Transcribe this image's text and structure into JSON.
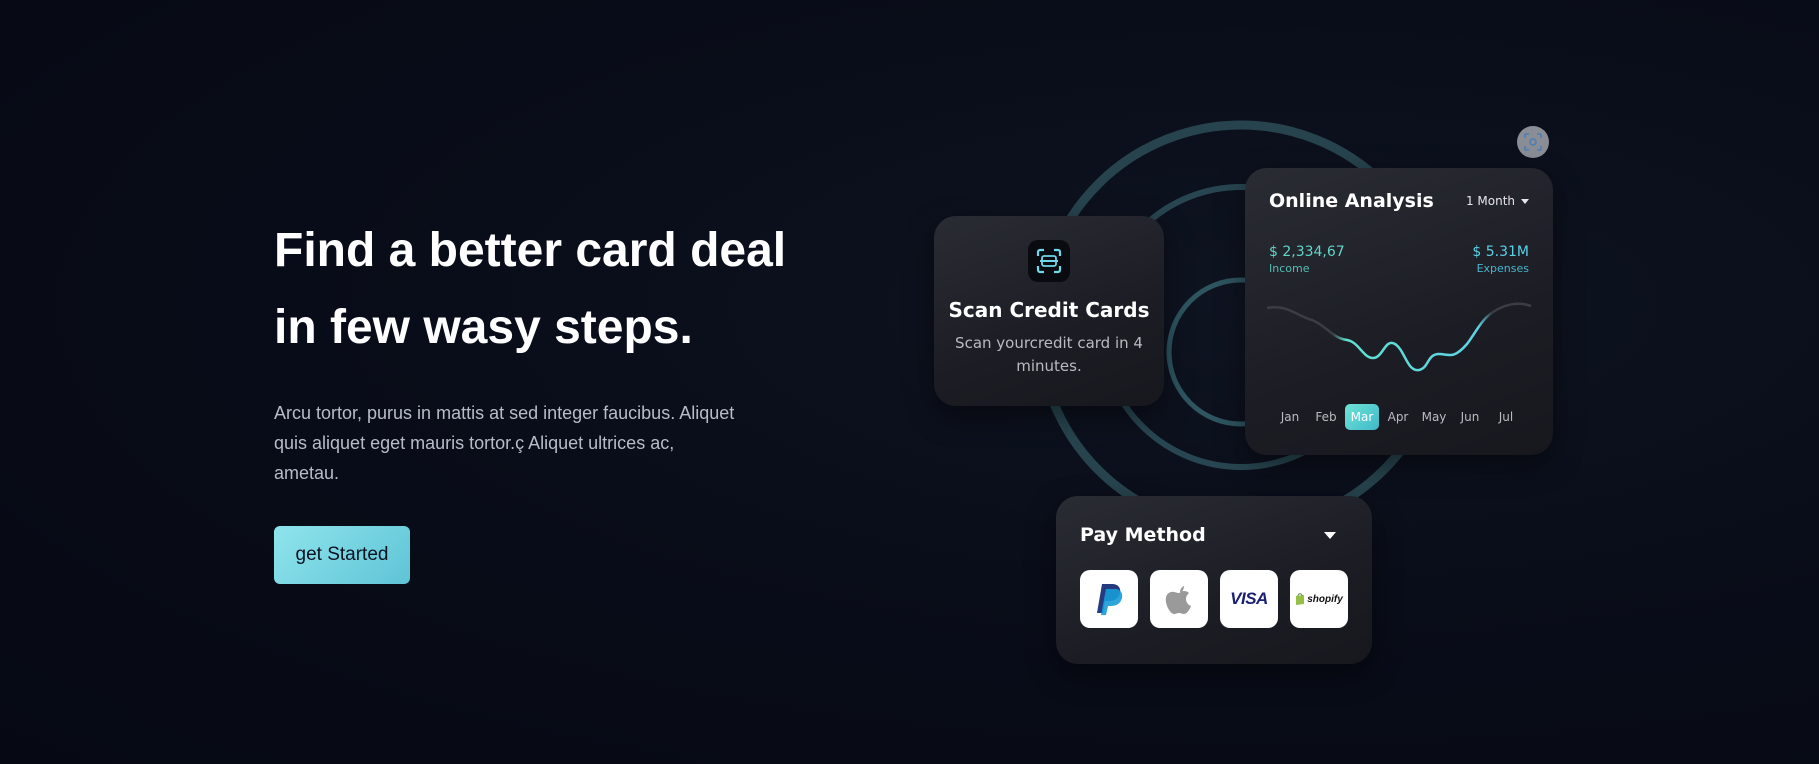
{
  "hero": {
    "headline_line1": "Find a better card deal",
    "headline_line2": "in few wasy steps.",
    "lead": "Arcu tortor, purus in mattis at sed integer faucibus. Aliquet quis aliquet eget mauris tortor.ç Aliquet ultrices ac, ametau.",
    "cta_label": "get Started"
  },
  "scan_card": {
    "icon": "scan-frame-icon",
    "title": "Scan Credit Cards",
    "subtitle": "Scan yourcredit card in 4 minutes."
  },
  "analysis_card": {
    "title": "Online Analysis",
    "period": "1 Month",
    "income_value": "$ 2,334,67",
    "income_label": "Income",
    "expenses_value": "$ 5.31M",
    "expenses_label": "Expenses",
    "months": [
      "Jan",
      "Feb",
      "Mar",
      "Apr",
      "May",
      "Jun",
      "Jul"
    ],
    "active_month": "Mar"
  },
  "pay_card": {
    "title": "Pay Method",
    "methods": [
      "paypal-icon",
      "apple-icon",
      "VISA",
      "shopify"
    ]
  },
  "colors": {
    "accent": "#5fd6c8",
    "cta_gradient_start": "#8fe4ec",
    "cta_gradient_end": "#5fc4d6",
    "ring": "#2c4b55"
  }
}
